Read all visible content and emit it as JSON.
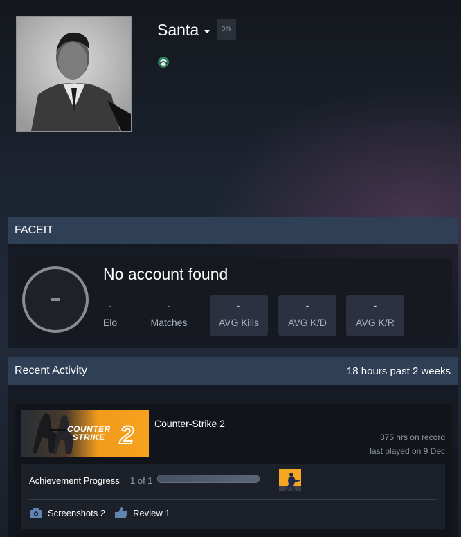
{
  "profile": {
    "name": "Santa",
    "completion_badge": "0%",
    "avatar": "profile-avatar-photo"
  },
  "faceit": {
    "title": "FACEIT",
    "status": "No account found",
    "level_placeholder": "-",
    "stats": [
      {
        "value": "-",
        "label": "Elo"
      },
      {
        "value": "-",
        "label": "Matches"
      },
      {
        "value": "-",
        "label": "AVG Kills"
      },
      {
        "value": "-",
        "label": "AVG K/D"
      },
      {
        "value": "-",
        "label": "AVG K/R"
      }
    ]
  },
  "activity": {
    "title": "Recent Activity",
    "summary": "18 hours past 2 weeks",
    "game": {
      "name": "Counter-Strike 2",
      "capsule_text": "COUNTER STRIKE",
      "capsule_number": "2",
      "hours": "375 hrs on record",
      "last_played": "last played on 9 Dec"
    },
    "achievements": {
      "label": "Achievement Progress",
      "count": "1 of 1",
      "progress": 1.0
    },
    "links": {
      "screenshots": "Screenshots 2",
      "review": "Review 1"
    }
  },
  "colors": {
    "panel_header": "#2f3f55",
    "stat_value": "#4f7ca8",
    "capsule_orange": "#f7a21e"
  },
  "icons": [
    "caret-down-icon",
    "badge-icon",
    "camera-icon",
    "thumbs-up-icon",
    "cs-achievement-icon"
  ]
}
